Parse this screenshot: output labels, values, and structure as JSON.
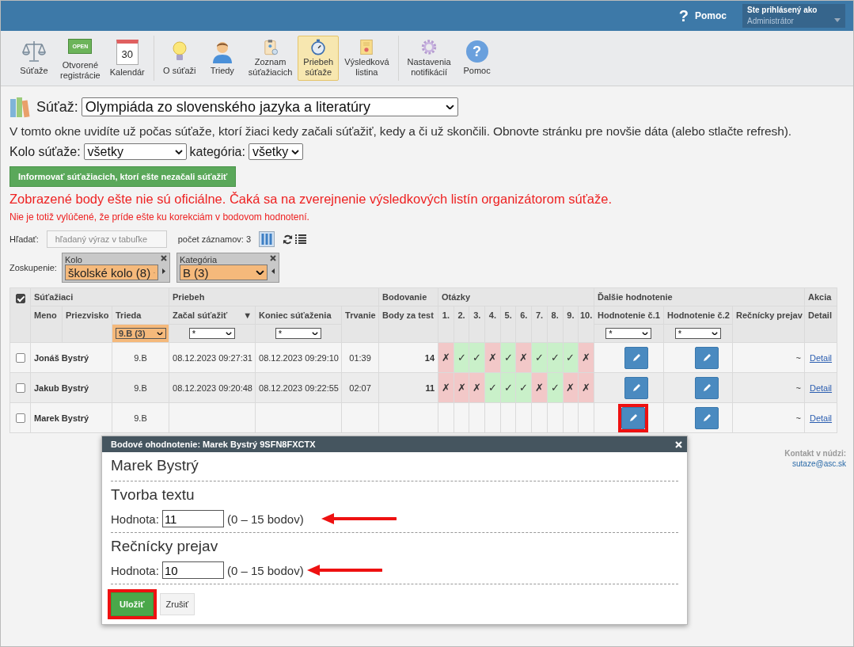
{
  "topbar": {
    "help_icon": "?",
    "help": "Pomoc",
    "user_label": "Ste prihlásený ako",
    "user": "Administrátor"
  },
  "toolbar": {
    "groups": [
      [
        {
          "label": "Súťaže",
          "selected": false
        },
        {
          "sign_text": "OPEN",
          "label": "Otvorené\nregistrácie",
          "selected": false
        },
        {
          "calendar_day": "30",
          "label": "Kalendár",
          "selected": false
        }
      ],
      [
        {
          "label": "O súťaži",
          "selected": false
        },
        {
          "label": "Triedy",
          "selected": false
        },
        {
          "label": "Zoznam\nsúťažiacich",
          "selected": false
        },
        {
          "label": "Priebeh\nsúťaže",
          "selected": true
        },
        {
          "label": "Výsledková\nlistina",
          "selected": false
        }
      ],
      [
        {
          "label": "Nastavenia\nnotifikácií",
          "selected": false
        },
        {
          "help_glyph": "?",
          "label": "Pomoc",
          "selected": false
        }
      ]
    ]
  },
  "contest": {
    "label": "Súťaž:",
    "value": "Olympiáda zo slovenského jazyka a literatúry"
  },
  "intro": "V tomto okne uvidíte už počas súťaže, ktorí žiaci kedy začali súťažiť, kedy a či už skončili. Obnovte stránku pre novšie dáta (alebo stlačte refresh).",
  "filters": {
    "round_label": "Kolo súťaže:",
    "round": "všetky",
    "category_label": "kategória:",
    "category": "všetky"
  },
  "notify_button": "Informovať súťažiacich, ktorí ešte nezačali súťažiť",
  "warning": "Zobrazené body ešte nie sú oficiálne. Čaká sa na zverejnenie výsledkových listín organizátorom súťaže.",
  "note": "Nie je totiž vylúčené, že príde ešte ku korekciám v bodovom hodnotení.",
  "search": {
    "label": "Hľadať:",
    "placeholder": "hľadaný výraz v tabuľke",
    "count": "počet záznamov: 3"
  },
  "grouping": {
    "label": "Zoskupenie:",
    "groups": [
      {
        "title": "Kolo",
        "value": "školské kolo (8)"
      },
      {
        "title": "Kategória",
        "value": "B (3)"
      }
    ]
  },
  "table": {
    "all_checked": true,
    "groups": [
      "Súťažiaci",
      "Priebeh",
      "Bodovanie",
      "Otázky",
      "Ďalšie hodnotenie",
      "Akcia"
    ],
    "columns": {
      "first_name": "Meno",
      "last_name": "Priezvisko",
      "class": "Trieda",
      "start": "Začal súťažiť",
      "start_sort": "▼",
      "end": "Koniec súťaženia",
      "duration": "Trvanie",
      "points": "Body za test",
      "questions": [
        "1.",
        "2.",
        "3.",
        "4.",
        "5.",
        "6.",
        "7.",
        "8.",
        "9.",
        "10."
      ],
      "rating1": "Hodnotenie č.1",
      "rating2": "Hodnotenie č.2",
      "speech": "Rečnícky prejav",
      "detail": "Detail"
    },
    "column_filters": {
      "class": {
        "value": "9.B (3)",
        "active": true
      },
      "start": {
        "value": "*",
        "active": false
      },
      "end": {
        "value": "*",
        "active": false
      },
      "rating1": {
        "value": "*",
        "active": false
      },
      "rating2": {
        "value": "*",
        "active": false
      }
    },
    "rows": [
      {
        "selected": false,
        "name": "Jonáš Bystrý",
        "class": "9.B",
        "start": "08.12.2023 09:27:31",
        "end": "08.12.2023 09:29:10",
        "duration": "01:39",
        "points": "14",
        "answers": [
          {
            "mark": "✗",
            "correct": false
          },
          {
            "mark": "✓",
            "correct": true
          },
          {
            "mark": "✓",
            "correct": true
          },
          {
            "mark": "✗",
            "correct": false
          },
          {
            "mark": "✓",
            "correct": true
          },
          {
            "mark": "✗",
            "correct": false
          },
          {
            "mark": "✓",
            "correct": true
          },
          {
            "mark": "✓",
            "correct": true
          },
          {
            "mark": "✓",
            "correct": true
          },
          {
            "mark": "✗",
            "correct": false
          }
        ],
        "speech": "~",
        "detail": "Detail",
        "rating1_highlighted": false
      },
      {
        "selected": false,
        "name": "Jakub Bystrý",
        "class": "9.B",
        "start": "08.12.2023 09:20:48",
        "end": "08.12.2023 09:22:55",
        "duration": "02:07",
        "points": "11",
        "answers": [
          {
            "mark": "✗",
            "correct": false
          },
          {
            "mark": "✗",
            "correct": false
          },
          {
            "mark": "✗",
            "correct": false
          },
          {
            "mark": "✓",
            "correct": true
          },
          {
            "mark": "✓",
            "correct": true
          },
          {
            "mark": "✓",
            "correct": true
          },
          {
            "mark": "✗",
            "correct": false
          },
          {
            "mark": "✓",
            "correct": true
          },
          {
            "mark": "✗",
            "correct": false
          },
          {
            "mark": "✗",
            "correct": false
          }
        ],
        "speech": "~",
        "detail": "Detail",
        "rating1_highlighted": false
      },
      {
        "selected": false,
        "name": "Marek Bystrý",
        "class": "9.B",
        "speech": "~",
        "detail": "Detail",
        "rating1_highlighted": true
      }
    ]
  },
  "contact": {
    "label": "Kontakt v núdzi:",
    "email": "sutaze@asc.sk"
  },
  "dialog": {
    "title": "Bodové ohodnotenie: Marek Bystrý 9SFN8FXCTX",
    "student": "Marek Bystrý",
    "sections": [
      {
        "heading": "Tvorba textu",
        "label": "Hodnota:",
        "value": "11",
        "range": "(0 – 15 bodov)",
        "annotated": true
      },
      {
        "heading": "Rečnícky prejav",
        "label": "Hodnota:",
        "value": "10",
        "range": "(0 – 15 bodov)",
        "annotated": true
      }
    ],
    "save": {
      "label": "Uložiť",
      "highlighted": true
    },
    "cancel": "Zrušiť"
  }
}
